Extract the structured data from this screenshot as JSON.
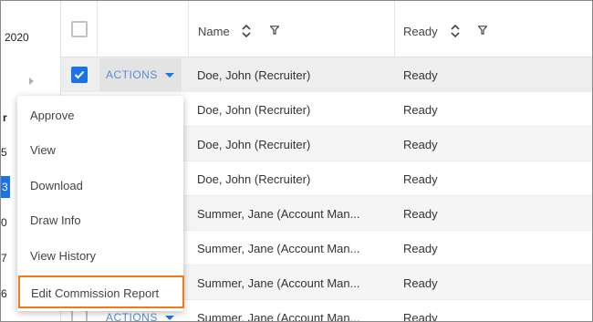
{
  "calendar_fragment": {
    "year": "2020",
    "fragments": [
      "r",
      "5",
      "3",
      "0",
      "7",
      "6"
    ]
  },
  "grid": {
    "columns": [
      {
        "label": "Name"
      },
      {
        "label": "Ready"
      }
    ],
    "actions_label": "ACTIONS",
    "rows": [
      {
        "name": "Doe, John (Recruiter)",
        "status": "Ready",
        "checked": true
      },
      {
        "name": "Doe, John (Recruiter)",
        "status": "Ready",
        "checked": false
      },
      {
        "name": "Doe, John (Recruiter)",
        "status": "Ready",
        "checked": false
      },
      {
        "name": "Doe, John (Recruiter)",
        "status": "Ready",
        "checked": false
      },
      {
        "name": "Summer, Jane (Account Man...",
        "status": "Ready",
        "checked": false
      },
      {
        "name": "Summer, Jane (Account Man...",
        "status": "Ready",
        "checked": false
      },
      {
        "name": "Summer, Jane (Account Man...",
        "status": "Ready",
        "checked": false
      },
      {
        "name": "Summer, Jane (Account Man...",
        "status": "Ready",
        "checked": false
      }
    ]
  },
  "actions_menu": {
    "items": [
      {
        "label": "Approve"
      },
      {
        "label": "View"
      },
      {
        "label": "Download"
      },
      {
        "label": "Draw Info"
      },
      {
        "label": "View History"
      },
      {
        "label": "Edit Commission Report",
        "highlighted": true
      }
    ]
  },
  "colors": {
    "accent": "#1a73e8",
    "highlight_outline": "#f07a1a",
    "row_alt": "#f5f5f5"
  }
}
